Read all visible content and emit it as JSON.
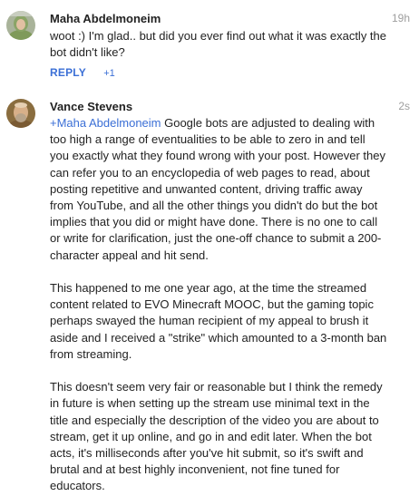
{
  "comments": [
    {
      "author": "Maha Abdelmoneim",
      "timestamp": "19h",
      "avatar": "avatar-woman-green-scarf",
      "body": "woot :) I'm glad.. but did you ever find out what it was exactly the bot didn't like?",
      "actions": {
        "reply_label": "REPLY",
        "plusone_label": "+1"
      }
    },
    {
      "author": "Vance Stevens",
      "timestamp": "2s",
      "avatar": "avatar-man-bearded",
      "mention": "+Maha Abdelmoneim",
      "paragraphs": [
        " Google bots are adjusted to dealing with too high a range of eventualities to be able to zero in and tell you exactly what they found wrong with your post. However they can refer you to an encyclopedia of web pages to read, about posting repetitive and unwanted content, driving traffic away from YouTube, and all the other things you didn't do but the bot implies that you did or might have done. There is no one to call or write for clarification, just the one-off chance to  submit a 200-character appeal and hit send.",
        "This happened to me one year ago, at the time the streamed content related to EVO Minecraft MOOC, but the gaming topic perhaps swayed the human recipient of my appeal to brush it aside and I received a \"strike\" which amounted to a 3-month ban from streaming.",
        "This doesn't seem very fair or reasonable but I think the remedy in future is when setting up the stream use minimal text in the title and especially the description of the video you are about to stream, get it up online, and go in and edit later. When the bot acts, it's milliseconds after you've hit submit, so it's swift and brutal and at best highly inconvenient, not fine tuned for educators."
      ]
    }
  ],
  "colors": {
    "link": "#3b6fd6",
    "text": "#222222",
    "timestamp": "#9e9e9e"
  }
}
